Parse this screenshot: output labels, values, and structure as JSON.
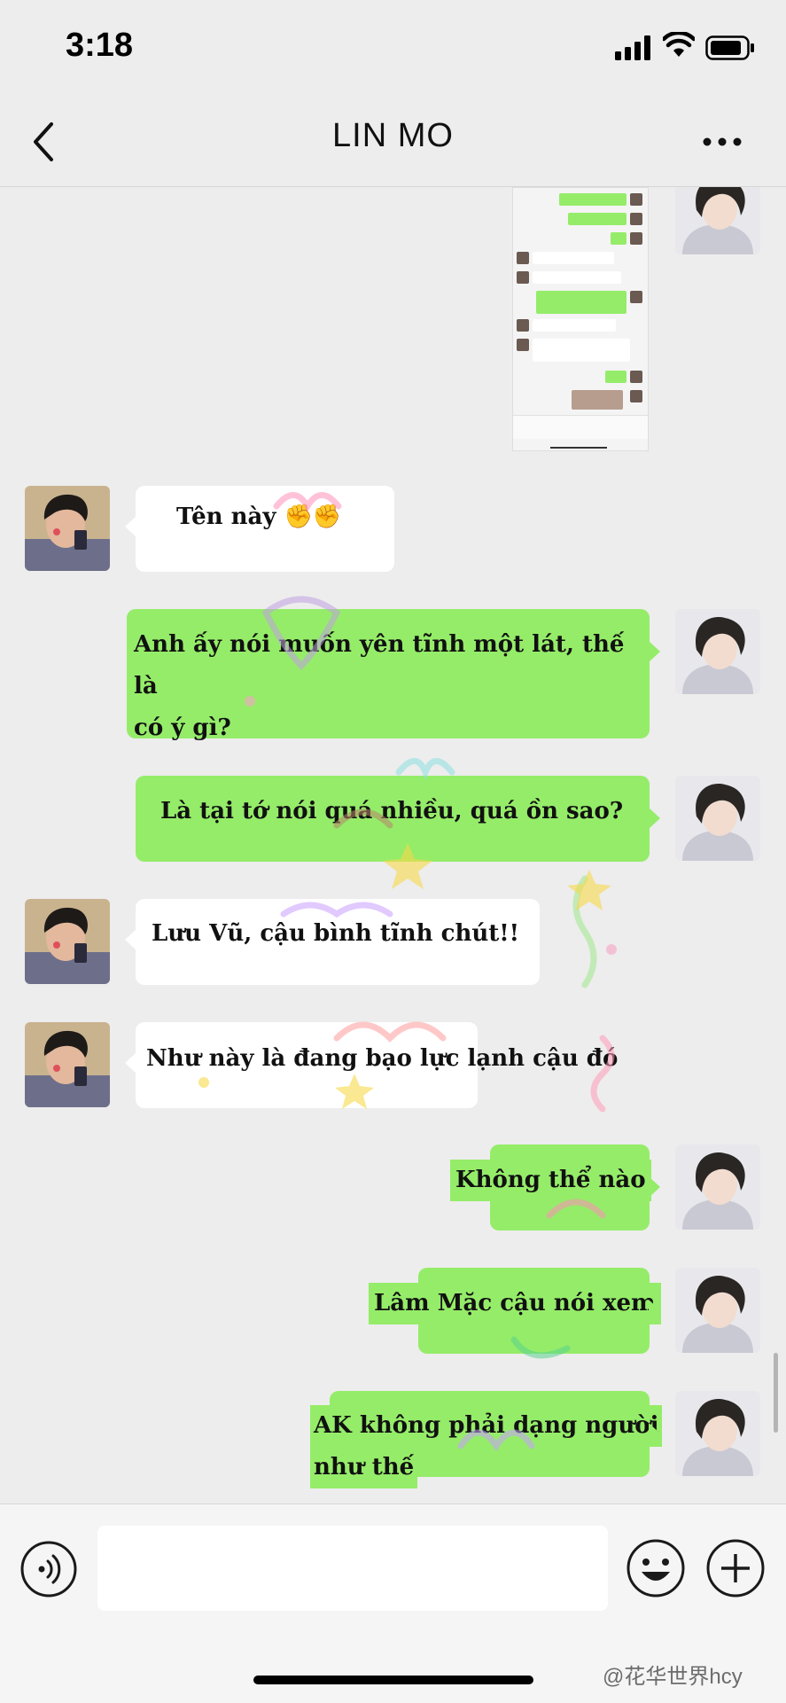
{
  "status": {
    "time": "3:18"
  },
  "nav": {
    "title": "LIN  MO"
  },
  "messages": [
    {
      "side": "left",
      "text": "Tên này ✊✊"
    },
    {
      "side": "right",
      "line1": "Anh ấy nói muốn yên tĩnh một lát, thế là",
      "line2": "có ý gì?"
    },
    {
      "side": "right",
      "text": "Là tại tớ nói quá nhiều, quá ồn sao?"
    },
    {
      "side": "left",
      "text": "Lưu Vũ, cậu bình tĩnh chút!!"
    },
    {
      "side": "left",
      "text": "Như này là đang bạo lực lạnh cậu đó"
    },
    {
      "side": "right",
      "text": "Không thể nào"
    },
    {
      "side": "right",
      "text": "Lâm Mặc cậu nói xem"
    },
    {
      "side": "right",
      "line1": "AK không phải dạng người",
      "line2": "như thế"
    }
  ],
  "screenshot_rows": [
    "一天都见不到你几面",
    "你到底在忙嘛呀?",
    "为什么总关注我在哪里呢?",
    "你自己难道没有事情做的吗?",
    "没有...我只是想关心一下你。我们不是情侣吗?",
    "那就请给我一点空间好吗?",
    "我想一个人冷静一段时间，你不要来找我",
    "好吧"
  ],
  "input": {
    "placeholder": ""
  },
  "watermark": "@花华世界hcy",
  "colors": {
    "bg": "#ededed",
    "green_bubble": "#95ec69",
    "white_bubble": "#ffffff"
  },
  "icons": [
    "back-chevron-icon",
    "more-dots-icon",
    "voice-icon",
    "emoji-icon",
    "plus-icon",
    "signal-icon",
    "wifi-icon",
    "battery-icon"
  ]
}
